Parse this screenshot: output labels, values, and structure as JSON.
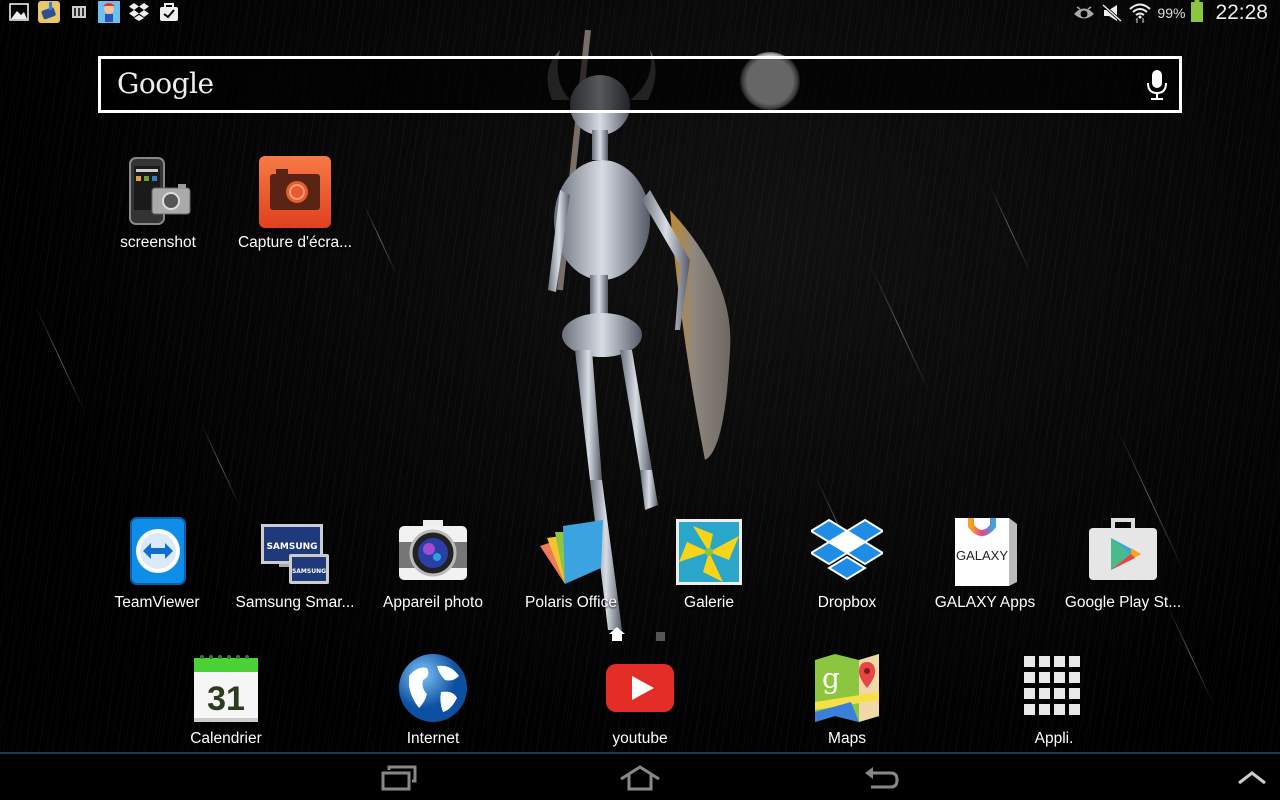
{
  "status_bar": {
    "notification_icons": [
      {
        "name": "gallery-notification-icon"
      },
      {
        "name": "cleaner-app-notification-icon"
      },
      {
        "name": "sim-card-notification-icon"
      },
      {
        "name": "game-notification-icon"
      },
      {
        "name": "dropbox-notification-icon"
      },
      {
        "name": "store-update-notification-icon"
      }
    ],
    "system_icons": [
      "smart-stay-eye-icon",
      "mute-icon",
      "wifi-icon"
    ],
    "battery_percent": "99%",
    "battery_level": 0.99,
    "time": "22:28"
  },
  "search": {
    "logo": "Google",
    "mic_icon": "microphone-icon"
  },
  "desktop_shortcuts": [
    {
      "label": "screenshot",
      "icon": "screenshot-app-icon"
    },
    {
      "label": "Capture d'écra...",
      "icon": "camera-capture-icon"
    }
  ],
  "apps_row": [
    {
      "label": "TeamViewer",
      "icon": "teamviewer-icon"
    },
    {
      "label": "Samsung Smar...",
      "icon": "samsung-smart-view-icon"
    },
    {
      "label": "Appareil photo",
      "icon": "camera-icon"
    },
    {
      "label": "Polaris Office",
      "icon": "polaris-office-icon"
    },
    {
      "label": "Galerie",
      "icon": "gallery-icon"
    },
    {
      "label": "Dropbox",
      "icon": "dropbox-icon"
    },
    {
      "label": "GALAXY Apps",
      "icon": "galaxy-apps-icon"
    },
    {
      "label": "Google Play St...",
      "icon": "google-play-store-icon"
    }
  ],
  "galaxy_text": "GALAXY",
  "samsung_text": "SAMSUNG",
  "calendar_day": "31",
  "page_indicator": {
    "pages": 2,
    "current": 1
  },
  "dock": [
    {
      "label": "Calendrier",
      "icon": "calendar-icon"
    },
    {
      "label": "Internet",
      "icon": "globe-icon"
    },
    {
      "label": "youtube",
      "icon": "youtube-icon"
    },
    {
      "label": "Maps",
      "icon": "maps-icon"
    },
    {
      "label": "Appli.",
      "icon": "app-drawer-icon"
    }
  ],
  "nav": {
    "recent": "recent-apps-icon",
    "home": "home-icon",
    "back": "back-icon",
    "up": "chevron-up-icon"
  },
  "colors": {
    "battery": "#8cc63f",
    "nav_border": "#1b3a4d",
    "calendar_green": "#4cd137",
    "youtube_red": "#e52d27",
    "dropbox_blue": "#1f8ce6",
    "teamviewer_blue": "#0e8ee9",
    "capture_orange": "#f0562a"
  }
}
